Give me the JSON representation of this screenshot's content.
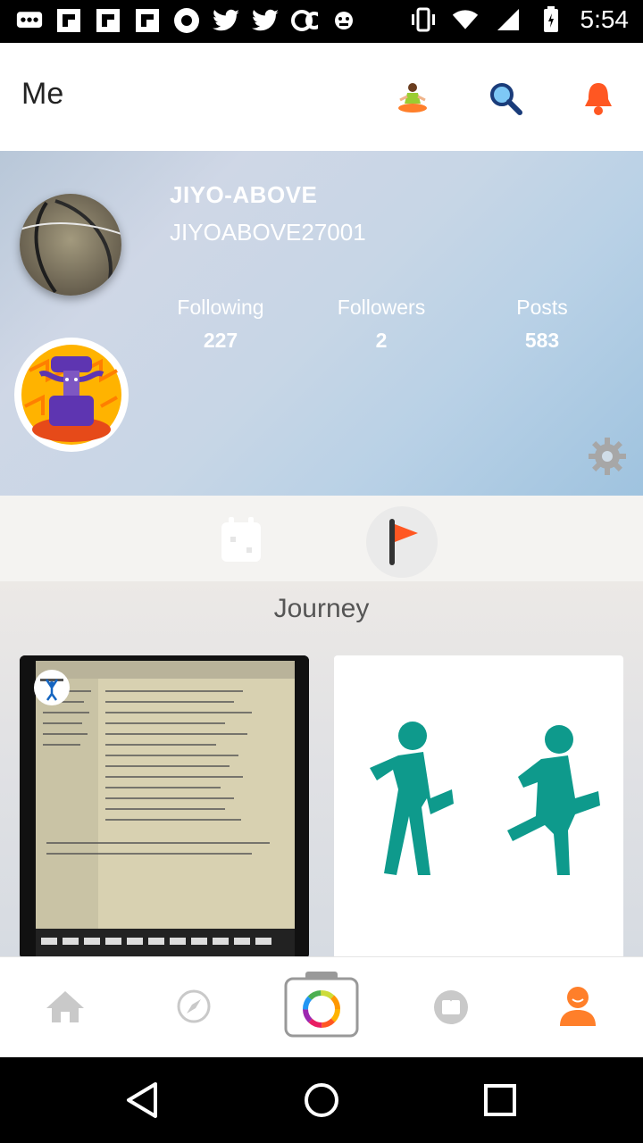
{
  "status_bar": {
    "time": "5:54",
    "left_icons": [
      "messages-icon",
      "flipboard-icon",
      "flipboard-icon",
      "flipboard-icon",
      "record-icon",
      "twitter-icon",
      "twitter-icon",
      "ce-icon",
      "monkey-icon"
    ],
    "right_icons": [
      "vibrate-icon",
      "wifi-icon",
      "signal-icon",
      "battery-icon"
    ]
  },
  "header": {
    "title": "Me",
    "actions": [
      "meditation-icon",
      "search-icon",
      "bell-icon"
    ]
  },
  "profile": {
    "name": "JIYO-ABOVE",
    "handle": "JIYOABOVE27001",
    "stats": [
      {
        "label": "Following",
        "value": "227"
      },
      {
        "label": "Followers",
        "value": "2"
      },
      {
        "label": "Posts",
        "value": "583"
      }
    ]
  },
  "tabs": [
    "calendar-icon",
    "flag-icon"
  ],
  "journey": {
    "title": "Journey"
  },
  "bottom_nav": {
    "items": [
      "home-icon",
      "compass-icon",
      "camera-icon",
      "tv-icon",
      "profile-icon"
    ],
    "active": "profile-icon"
  },
  "colors": {
    "accent": "#ff7f2a",
    "walk": "#0e9a8c",
    "nav_inactive": "#c9c9c9"
  }
}
